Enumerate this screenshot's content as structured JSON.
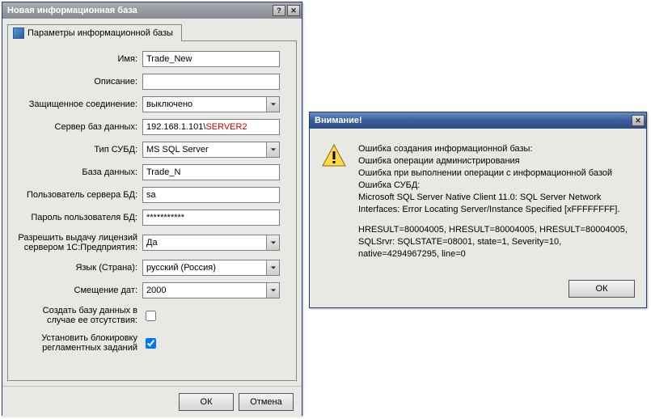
{
  "main": {
    "title": "Новая информационная база",
    "tab_label": "Параметры информационной базы",
    "labels": {
      "name": "Имя:",
      "description": "Описание:",
      "secure": "Защищенное соединение:",
      "dbserver": "Сервер баз данных:",
      "dbms": "Тип СУБД:",
      "database": "База данных:",
      "dbuser": "Пользователь сервера БД:",
      "dbpass": "Пароль пользователя БД:",
      "lic": "Разрешить выдачу лицензий сервером 1С:Предприятия:",
      "lang": "Язык (Страна):",
      "offset": "Смещение дат:",
      "createdb": "Создать базу данных в случае ее отсутствия:",
      "lockjobs": "Установить блокировку регламентных заданий"
    },
    "values": {
      "name": "Trade_New",
      "description": "",
      "secure": "выключено",
      "dbserver_left": "192.168.1.101\\",
      "dbserver_right": "SERVER2",
      "dbms": "MS SQL Server",
      "database": "Trade_N",
      "dbuser": "sa",
      "dbpass": "***********",
      "lic": "Да",
      "lang": "русский (Россия)",
      "offset": "2000"
    },
    "buttons": {
      "ok": "ОК",
      "cancel": "Отмена"
    }
  },
  "alert": {
    "title": "Внимание!",
    "lines": [
      "Ошибка создания информационной базы:",
      "Ошибка операции администрирования",
      "Ошибка при выполнении операции с информационной базой",
      "Ошибка СУБД:",
      "Microsoft SQL Server Native Client 11.0: SQL Server Network Interfaces: Error Locating Server/Instance Specified [xFFFFFFFF].",
      "",
      "HRESULT=80004005, HRESULT=80004005, HRESULT=80004005,",
      "SQLSrvr: SQLSTATE=08001, state=1, Severity=10,",
      "native=4294967295, line=0"
    ],
    "ok": "ОК"
  }
}
